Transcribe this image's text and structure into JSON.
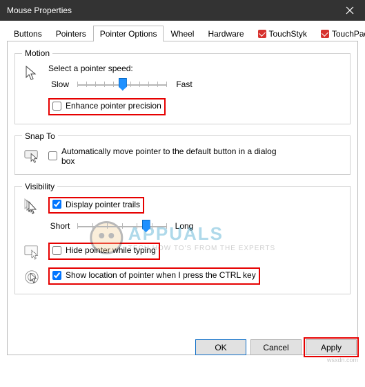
{
  "window": {
    "title": "Mouse Properties"
  },
  "tabs": {
    "items": [
      {
        "label": "Buttons"
      },
      {
        "label": "Pointers"
      },
      {
        "label": "Pointer Options"
      },
      {
        "label": "Wheel"
      },
      {
        "label": "Hardware"
      },
      {
        "label": "TouchStyk"
      },
      {
        "label": "TouchPad"
      }
    ],
    "active_index": 2
  },
  "groups": {
    "motion": {
      "legend": "Motion",
      "speed_caption": "Select a pointer speed:",
      "slow_label": "Slow",
      "fast_label": "Fast",
      "enhance_label": "Enhance pointer precision",
      "enhance_checked": false
    },
    "snapto": {
      "legend": "Snap To",
      "auto_label": "Automatically move pointer to the default button in a dialog box",
      "auto_checked": false
    },
    "visibility": {
      "legend": "Visibility",
      "trails_label": "Display pointer trails",
      "trails_checked": true,
      "short_label": "Short",
      "long_label": "Long",
      "hide_label": "Hide pointer while typing",
      "hide_checked": false,
      "ctrl_label": "Show location of pointer when I press the CTRL key",
      "ctrl_checked": true
    }
  },
  "buttons": {
    "ok": "OK",
    "cancel": "Cancel",
    "apply": "Apply"
  },
  "watermark": {
    "brand": "APPUALS",
    "tagline": "TECH HOW TO'S FROM THE EXPERTS"
  },
  "source": "wsxdn.com"
}
